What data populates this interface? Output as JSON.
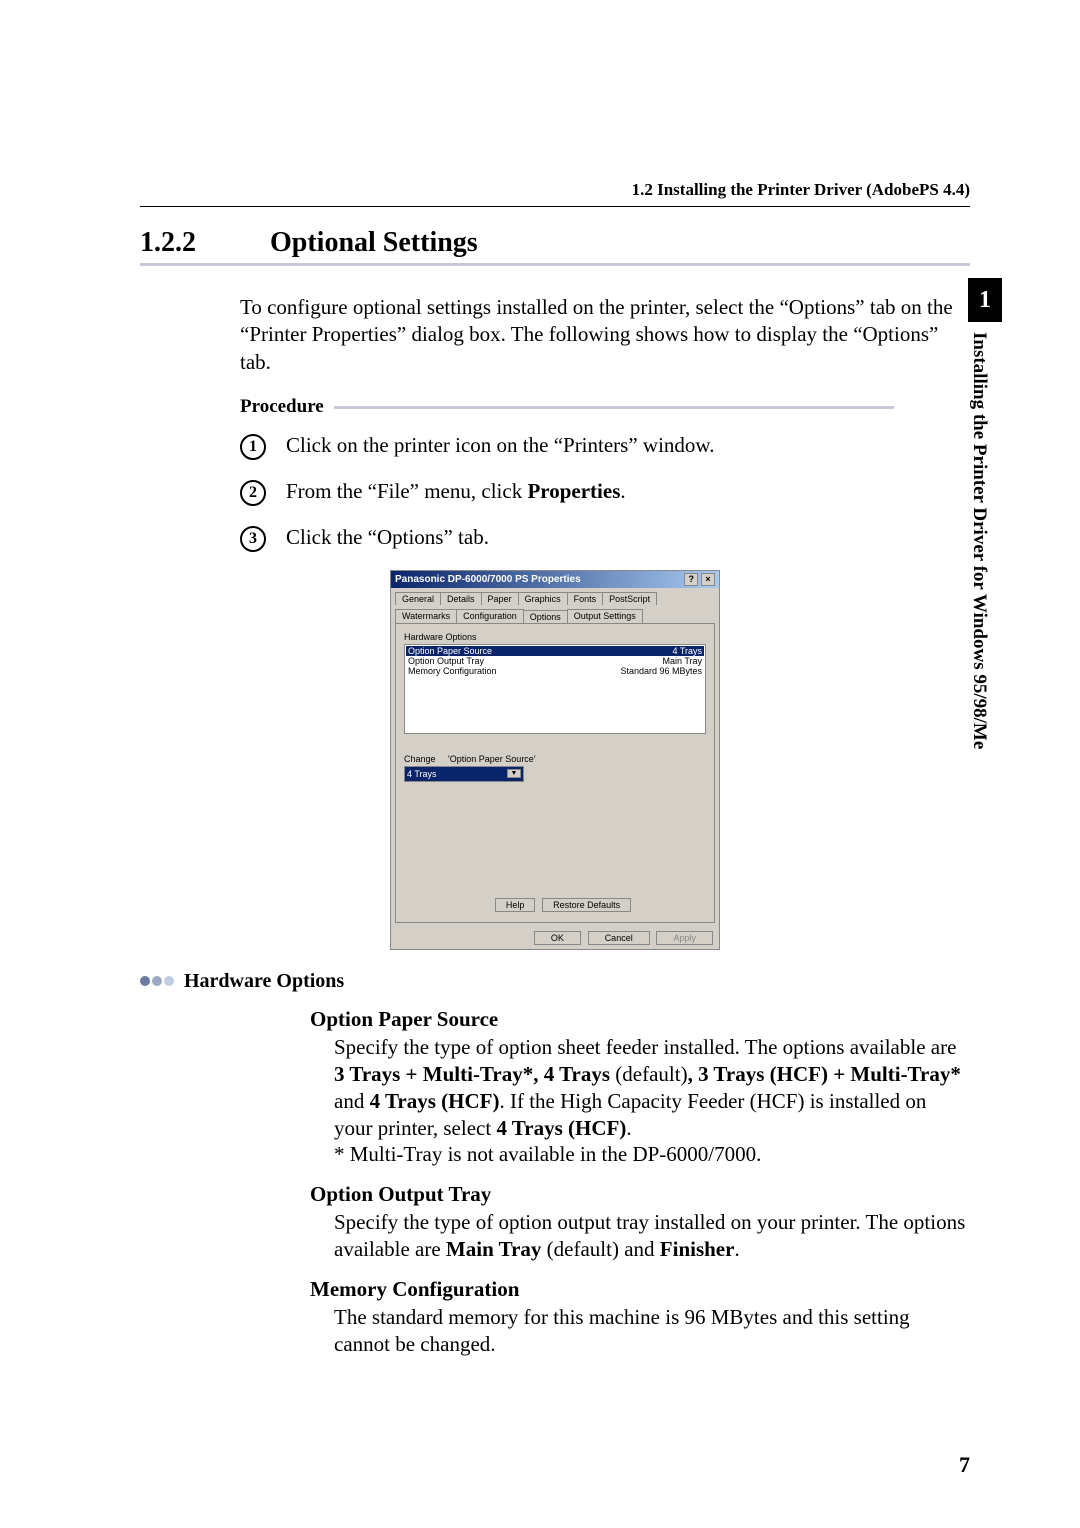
{
  "header": {
    "running_head": "1.2    Installing the Printer Driver (AdobePS 4.4)"
  },
  "section": {
    "number": "1.2.2",
    "title": "Optional Settings"
  },
  "intro": "To configure optional settings installed on the printer, select the “Options” tab on the “Printer Properties” dialog box. The following shows how to display the “Options” tab.",
  "procedure_label": "Procedure",
  "steps": {
    "s1": "Click on the printer icon on the “Printers” window.",
    "s2_pre": "From the “File” menu, click ",
    "s2_bold": "Properties",
    "s2_post": ".",
    "s3": "Click the “Options” tab."
  },
  "dialog": {
    "title": "Panasonic DP-6000/7000 PS Properties",
    "btn_help": "?",
    "btn_close": "×",
    "tabs": {
      "general": "General",
      "details": "Details",
      "paper": "Paper",
      "graphics": "Graphics",
      "fonts": "Fonts",
      "postscript": "PostScript",
      "watermarks": "Watermarks",
      "configuration": "Configuration",
      "options": "Options",
      "output": "Output Settings"
    },
    "group_label": "Hardware Options",
    "list": {
      "r1_name": "Option Paper Source",
      "r1_val": "4 Trays",
      "r2_name": "Option Output Tray",
      "r2_val": "Main Tray",
      "r3_name": "Memory Configuration",
      "r3_val": "Standard 96 MBytes"
    },
    "change_label": "Change",
    "change_caption": "'Option Paper Source'",
    "select_value": "4 Trays",
    "btn_help2": "Help",
    "btn_restore": "Restore Defaults",
    "btn_ok": "OK",
    "btn_cancel": "Cancel",
    "btn_apply": "Apply"
  },
  "hw_options_heading": "Hardware Options",
  "options": {
    "paper_source": {
      "title": "Option Paper Source",
      "line1": "Specify the type of option sheet feeder installed. The options available are ",
      "b1": "3 Trays + Multi-Tray*, 4 Trays",
      "mid1": "  (default)",
      "b2": ", 3 Trays (HCF) + Multi-Tray*",
      "mid2": " and ",
      "b3": "4 Trays (HCF)",
      "mid3": ". If the High Capacity Feeder (HCF) is installed on your printer, select ",
      "b4": "4 Trays (HCF)",
      "mid4": ".",
      "note": "* Multi-Tray is not available in the DP-6000/7000."
    },
    "output_tray": {
      "title": "Option Output Tray",
      "line1": "Specify the type of option output tray installed on your printer. The options available are ",
      "b1": "Main Tray",
      "mid1": " (default) and ",
      "b2": "Finisher",
      "mid2": "."
    },
    "memory": {
      "title": "Memory Configuration",
      "body": "The standard memory for this machine is 96 MBytes and this setting cannot be changed."
    }
  },
  "side_tab": {
    "num": "1",
    "text": "Installing the Printer Driver for Windows 95/98/Me"
  },
  "pagenum": "7"
}
